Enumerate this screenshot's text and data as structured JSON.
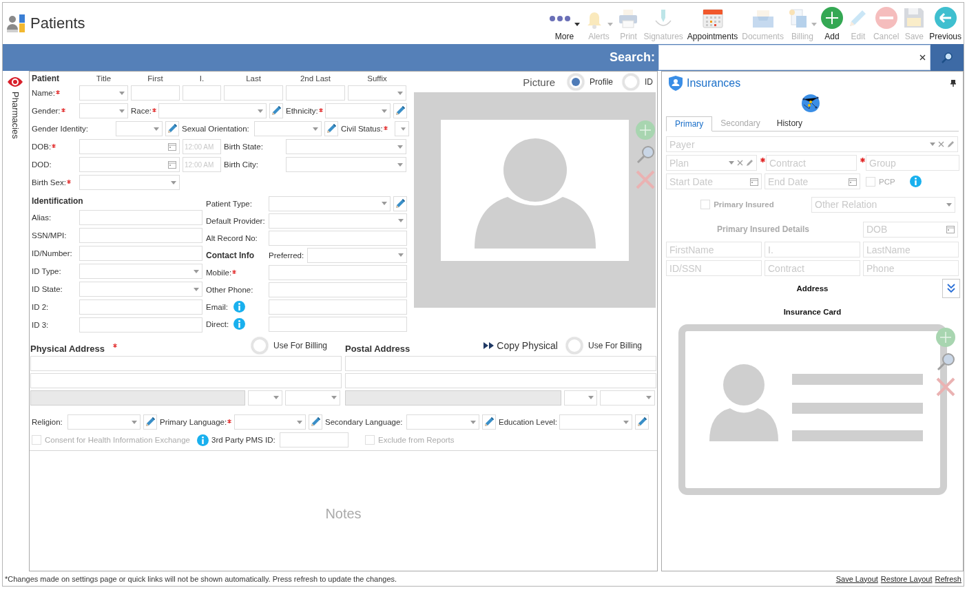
{
  "app": {
    "title": "Patients"
  },
  "toolbar": [
    {
      "label": "More",
      "kind": "more",
      "disabled": false,
      "dropdown": true
    },
    {
      "label": "Alerts",
      "kind": "alerts",
      "disabled": true,
      "dropdown": true
    },
    {
      "label": "Print",
      "kind": "print",
      "disabled": true,
      "dropdown": false
    },
    {
      "label": "Signatures",
      "kind": "signatures",
      "disabled": true,
      "dropdown": false
    },
    {
      "label": "Appointments",
      "kind": "appointments",
      "disabled": false,
      "dropdown": false
    },
    {
      "label": "Documents",
      "kind": "documents",
      "disabled": true,
      "dropdown": false
    },
    {
      "label": "Billing",
      "kind": "billing",
      "disabled": true,
      "dropdown": true
    },
    {
      "label": "Add",
      "kind": "add",
      "disabled": false,
      "dropdown": false
    },
    {
      "label": "Edit",
      "kind": "edit",
      "disabled": true,
      "dropdown": false
    },
    {
      "label": "Cancel",
      "kind": "cancel",
      "disabled": true,
      "dropdown": false
    },
    {
      "label": "Save",
      "kind": "save",
      "disabled": true,
      "dropdown": false
    },
    {
      "label": "Previous",
      "kind": "previous",
      "disabled": false,
      "dropdown": false
    }
  ],
  "search": {
    "label": "Search:"
  },
  "side_tabs": [
    {
      "label": "Pharmacies"
    }
  ],
  "patient": {
    "header_row": [
      {
        "kind": "heading",
        "text": "Patient"
      },
      {
        "kind": "colhead",
        "text": "Title"
      },
      {
        "kind": "colhead",
        "text": "First"
      },
      {
        "kind": "colhead",
        "text": "I."
      },
      {
        "kind": "colhead",
        "text": "Last"
      },
      {
        "kind": "colhead",
        "text": "2nd Last"
      },
      {
        "kind": "colhead",
        "text": "Suffix"
      }
    ],
    "rows": [
      [
        {
          "kind": "label",
          "text": "Name:",
          "required": true
        },
        {
          "kind": "select"
        },
        {
          "kind": "text"
        },
        {
          "kind": "text"
        },
        {
          "kind": "text"
        },
        {
          "kind": "text"
        },
        {
          "kind": "select"
        }
      ],
      [
        {
          "kind": "label",
          "text": "Gender:",
          "required": true
        },
        {
          "kind": "select"
        },
        {
          "kind": "label",
          "text": "Race:",
          "required": true
        },
        {
          "kind": "select"
        },
        {
          "kind": "edit"
        },
        {
          "kind": "label",
          "text": "Ethnicity:",
          "required": true
        },
        {
          "kind": "select"
        },
        {
          "kind": "edit"
        }
      ],
      [
        {
          "kind": "label",
          "text": "Gender Identity:",
          "required": false
        },
        {
          "kind": "select"
        },
        {
          "kind": "edit"
        },
        {
          "kind": "label",
          "text": "Sexual Orientation:",
          "required": false
        },
        {
          "kind": "select"
        },
        {
          "kind": "edit"
        },
        {
          "kind": "label",
          "text": "Civil Status:",
          "required": true
        },
        {
          "kind": "select"
        }
      ],
      [
        {
          "kind": "label",
          "text": "DOB:",
          "required": true
        },
        {
          "kind": "date"
        },
        {
          "kind": "time",
          "placeholder": "12:00 AM"
        },
        {
          "kind": "label",
          "text": "Birth State:",
          "required": false
        },
        {
          "kind": "select"
        }
      ],
      [
        {
          "kind": "label",
          "text": "DOD:",
          "required": false
        },
        {
          "kind": "date"
        },
        {
          "kind": "time",
          "placeholder": "12:00 AM"
        },
        {
          "kind": "label",
          "text": "Birth City:",
          "required": false
        },
        {
          "kind": "select"
        }
      ],
      [
        {
          "kind": "label",
          "text": "Birth Sex:",
          "required": true
        },
        {
          "kind": "select"
        }
      ]
    ],
    "identification": [
      [
        {
          "kind": "heading",
          "text": "Identification"
        }
      ],
      [
        {
          "kind": "label",
          "text": "Alias:",
          "required": false
        },
        {
          "kind": "text"
        }
      ],
      [
        {
          "kind": "label",
          "text": "SSN/MPI:",
          "required": false
        },
        {
          "kind": "text"
        }
      ],
      [
        {
          "kind": "label",
          "text": "ID/Number:",
          "required": false
        },
        {
          "kind": "text"
        }
      ],
      [
        {
          "kind": "label",
          "text": "ID Type:",
          "required": false
        },
        {
          "kind": "select"
        }
      ],
      [
        {
          "kind": "label",
          "text": "ID State:",
          "required": false
        },
        {
          "kind": "select"
        }
      ],
      [
        {
          "kind": "label",
          "text": "ID 2:",
          "required": false
        },
        {
          "kind": "text"
        }
      ],
      [
        {
          "kind": "label",
          "text": "ID 3:",
          "required": false
        },
        {
          "kind": "text"
        }
      ]
    ],
    "contact": [
      [
        {
          "kind": "label",
          "text": "Patient Type:",
          "required": false
        },
        {
          "kind": "select"
        },
        {
          "kind": "edit"
        }
      ],
      [
        {
          "kind": "label",
          "text": "Default Provider:",
          "required": false
        },
        {
          "kind": "select"
        }
      ],
      [
        {
          "kind": "label",
          "text": "Alt Record No:",
          "required": false
        },
        {
          "kind": "text"
        }
      ],
      [
        {
          "kind": "heading",
          "text": "Contact Info"
        },
        {
          "kind": "label",
          "text": "Preferred:",
          "required": false
        },
        {
          "kind": "select"
        }
      ],
      [
        {
          "kind": "label",
          "text": "Mobile:",
          "required": true
        },
        {
          "kind": "text"
        }
      ],
      [
        {
          "kind": "label",
          "text": "Other Phone:",
          "required": false
        },
        {
          "kind": "text"
        }
      ],
      [
        {
          "kind": "label",
          "text": "Email:",
          "required": false
        },
        {
          "kind": "info"
        },
        {
          "kind": "text"
        }
      ],
      [
        {
          "kind": "label",
          "text": "Direct:",
          "required": false
        },
        {
          "kind": "info"
        },
        {
          "kind": "text"
        }
      ]
    ]
  },
  "picture": {
    "label": "Picture",
    "options": [
      {
        "label": "Profile",
        "selected": true
      },
      {
        "label": "ID",
        "selected": false
      }
    ]
  },
  "physical_address": {
    "title": "Physical Address",
    "required": true,
    "use_for_billing": {
      "label": "Use For Billing",
      "selected": false
    },
    "rows": [
      [
        {
          "kind": "text",
          "disabled": false
        }
      ],
      [
        {
          "kind": "text",
          "disabled": false
        }
      ],
      [
        {
          "kind": "text",
          "disabled": true
        },
        {
          "kind": "select"
        },
        {
          "kind": "select"
        }
      ]
    ]
  },
  "postal_address": {
    "title": "Postal Address",
    "copy_button": {
      "label": "Copy Physical"
    },
    "use_for_billing": {
      "label": "Use For Billing",
      "selected": false
    },
    "rows": [
      [
        {
          "kind": "text",
          "disabled": false
        }
      ],
      [
        {
          "kind": "text",
          "disabled": false
        }
      ],
      [
        {
          "kind": "text",
          "disabled": true
        },
        {
          "kind": "select"
        },
        {
          "kind": "select"
        }
      ]
    ]
  },
  "demographics": [
    {
      "kind": "label",
      "text": "Religion:",
      "required": false
    },
    {
      "kind": "select"
    },
    {
      "kind": "edit"
    },
    {
      "kind": "label",
      "text": "Primary Language:",
      "required": true
    },
    {
      "kind": "select"
    },
    {
      "kind": "edit"
    },
    {
      "kind": "label",
      "text": "Secondary Language:",
      "required": false
    },
    {
      "kind": "select"
    },
    {
      "kind": "edit"
    },
    {
      "kind": "label",
      "text": "Education Level:",
      "required": false
    },
    {
      "kind": "select"
    },
    {
      "kind": "edit"
    }
  ],
  "options_row": [
    {
      "kind": "checkbox",
      "label": "Consent for Health Information Exchange",
      "checked": false,
      "disabled": true
    },
    {
      "kind": "info"
    },
    {
      "kind": "label",
      "text": "3rd Party PMS ID:",
      "required": false
    },
    {
      "kind": "text"
    },
    {
      "kind": "checkbox",
      "label": "Exclude from Reports",
      "checked": false,
      "disabled": true
    }
  ],
  "notes": {
    "placeholder": "Notes"
  },
  "insurances": {
    "title": "Insurances",
    "tabs": [
      {
        "label": "Primary",
        "selected": true,
        "disabled": false
      },
      {
        "label": "Secondary",
        "selected": false,
        "disabled": true
      },
      {
        "label": "History",
        "selected": false,
        "disabled": false
      }
    ],
    "rows": [
      [
        {
          "kind": "combo",
          "placeholder": "Payer",
          "required": false
        }
      ],
      [
        {
          "kind": "combo",
          "placeholder": "Plan",
          "required": false
        },
        {
          "kind": "text",
          "placeholder": "Contract",
          "required": true
        },
        {
          "kind": "text",
          "placeholder": "Group",
          "required": true
        }
      ],
      [
        {
          "kind": "date",
          "placeholder": "Start Date"
        },
        {
          "kind": "date",
          "placeholder": "End Date"
        },
        {
          "kind": "checkbox",
          "label": "PCP",
          "checked": false,
          "disabled": true
        },
        {
          "kind": "info"
        }
      ],
      [
        {
          "kind": "checkbox",
          "label": "Primary Insured",
          "checked": false,
          "disabled": true,
          "bold": true
        },
        {
          "kind": "select",
          "placeholder": "Other Relation"
        }
      ],
      [
        {
          "kind": "heading",
          "text": "Primary Insured Details",
          "disabled": true
        },
        {
          "kind": "date",
          "placeholder": "DOB"
        }
      ],
      [
        {
          "kind": "text",
          "placeholder": "FirstName"
        },
        {
          "kind": "text",
          "placeholder": "I."
        },
        {
          "kind": "text",
          "placeholder": "LastName"
        }
      ],
      [
        {
          "kind": "text",
          "placeholder": "ID/SSN"
        },
        {
          "kind": "text",
          "placeholder": "Contract"
        },
        {
          "kind": "text",
          "placeholder": "Phone"
        }
      ]
    ],
    "address_label": "Address",
    "card_label": "Insurance Card"
  },
  "footer": {
    "note": "*Changes made on settings page or quick links will not be shown automatically. Press refresh to update the changes.",
    "links": [
      {
        "label": "Save Layout"
      },
      {
        "label": "Restore Layout"
      },
      {
        "label": "Refresh"
      }
    ]
  }
}
